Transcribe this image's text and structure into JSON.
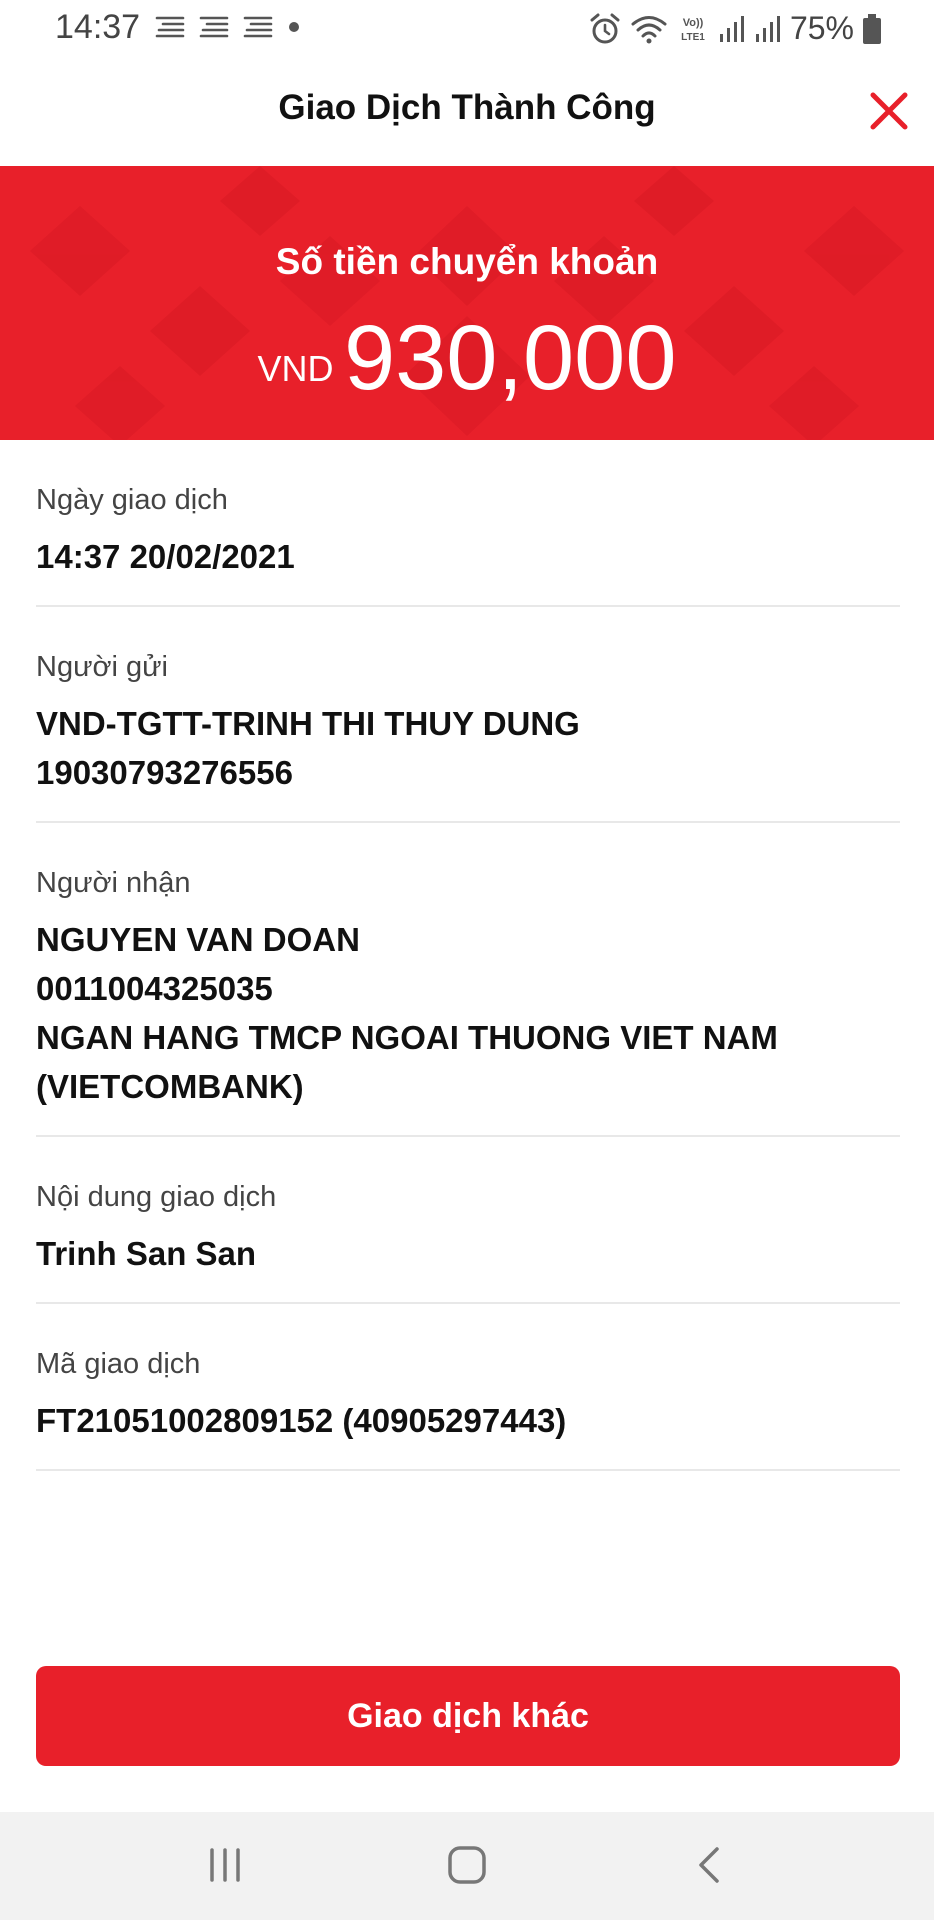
{
  "status_bar": {
    "time": "14:37",
    "battery": "75%",
    "icons": [
      "notification-icon",
      "notification-icon",
      "notification-icon",
      "dot-icon",
      "alarm-icon",
      "wifi-icon",
      "volte-icon",
      "signal-icon",
      "signal-icon",
      "battery-icon"
    ]
  },
  "header": {
    "title": "Giao Dịch Thành Công",
    "close_icon": "close-icon",
    "accent_color": "#e8202a"
  },
  "amount": {
    "label": "Số tiền chuyển khoản",
    "currency": "VND",
    "value": "930,000"
  },
  "details": {
    "date": {
      "label": "Ngày giao dịch",
      "value": "14:37 20/02/2021"
    },
    "sender": {
      "label": "Người gửi",
      "name": "VND-TGTT-TRINH THI THUY DUNG",
      "account": "19030793276556"
    },
    "recipient": {
      "label": "Người nhận",
      "name": "NGUYEN VAN DOAN",
      "account": "0011004325035",
      "bank_line1": "NGAN HANG TMCP NGOAI THUONG VIET NAM",
      "bank_line2": "(VIETCOMBANK)"
    },
    "content": {
      "label": "Nội dung giao dịch",
      "value": "Trinh San San"
    },
    "code": {
      "label": "Mã giao dịch",
      "value": "FT21051002809152 (40905297443)"
    }
  },
  "actions": {
    "other_transaction": "Giao dịch khác"
  },
  "nav": {
    "icons": [
      "recent-apps-icon",
      "home-icon",
      "back-icon"
    ]
  }
}
